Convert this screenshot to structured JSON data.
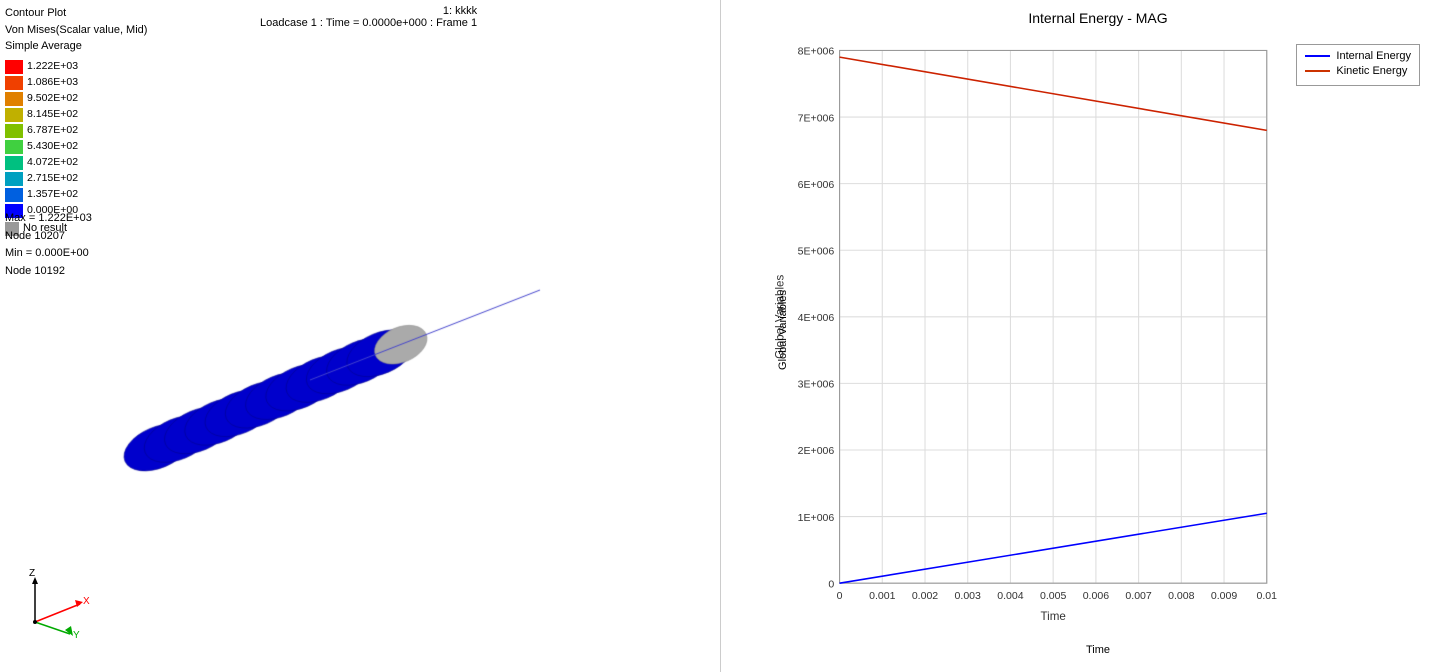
{
  "left": {
    "contour_plot_label": "Contour Plot",
    "von_mises_label": "Von Mises(Scalar value, Mid)",
    "simple_average_label": "Simple Average",
    "loadcase_label": "1: kkkk",
    "loadcase_detail": "Loadcase 1 : Time = 0.0000e+000 : Frame 1",
    "legend": [
      {
        "color": "#ff0000",
        "value": "1.222E+03"
      },
      {
        "color": "#f04000",
        "value": "1.086E+03"
      },
      {
        "color": "#e08000",
        "value": "9.502E+02"
      },
      {
        "color": "#c0b000",
        "value": "8.145E+02"
      },
      {
        "color": "#80c000",
        "value": "6.787E+02"
      },
      {
        "color": "#40d040",
        "value": "5.430E+02"
      },
      {
        "color": "#00c080",
        "value": "4.072E+02"
      },
      {
        "color": "#00a0c0",
        "value": "2.715E+02"
      },
      {
        "color": "#0060e0",
        "value": "1.357E+02"
      },
      {
        "color": "#0000ff",
        "value": "0.000E+00"
      }
    ],
    "no_result_label": "No result",
    "max_label": "Max = 1.222E+03",
    "node_max_label": "Node 10207",
    "min_label": "Min = 0.000E+00",
    "node_min_label": "Node 10192",
    "axes": {
      "z_label": "Z",
      "y_label": "Y",
      "x_label": "X"
    }
  },
  "right": {
    "chart_title": "Internal Energy - MAG",
    "y_axis_label": "Global Variables",
    "x_axis_label": "Time",
    "y_ticks": [
      "0",
      "1E+006",
      "2E+006",
      "3E+006",
      "4E+006",
      "5E+006",
      "6E+006",
      "7E+006",
      "8E+006"
    ],
    "x_ticks": [
      "0",
      "0.001",
      "0.002",
      "0.003",
      "0.004",
      "0.005",
      "0.006",
      "0.007",
      "0.008",
      "0.009",
      "0.01"
    ],
    "legend": {
      "internal_energy_label": "Internal Energy",
      "internal_energy_color": "#0000ff",
      "kinetic_energy_label": "Kinetic Energy",
      "kinetic_energy_color": "#cc3300"
    },
    "internal_energy_start": 0,
    "internal_energy_end": 1050000,
    "kinetic_energy_start": 7900000,
    "kinetic_energy_end": 6800000
  }
}
